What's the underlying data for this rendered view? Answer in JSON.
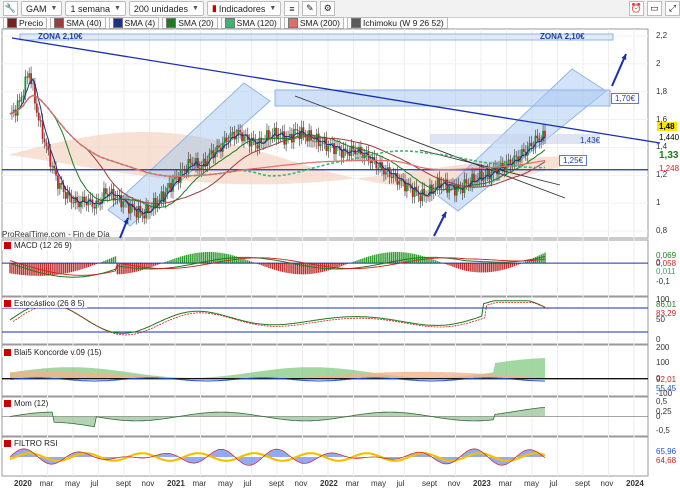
{
  "toolbar": {
    "symbol": "GAM",
    "timeframe": "1 semana",
    "units": "200 unidades",
    "indicators": "Indicadores"
  },
  "legend": [
    {
      "label": "Precio",
      "color": "#7a1f1f"
    },
    {
      "label": "SMA (40)",
      "color": "#9e3b3b"
    },
    {
      "label": "SMA (4)",
      "color": "#1c2f8a"
    },
    {
      "label": "SMA (20)",
      "color": "#1e7a1e"
    },
    {
      "label": "SMA (120)",
      "color": "#3cb371"
    },
    {
      "label": "SMA (200)",
      "color": "#e46a6a"
    },
    {
      "label": "Ichimoku (W 9 26 52)",
      "color": "#5a5a5a"
    }
  ],
  "annotations": {
    "zona_left": "ZONA 2,10€",
    "zona_right": "ZONA 2,10€",
    "target": "1,70€",
    "resistance": "1,43€",
    "support": "1,25€",
    "watermark": "ProRealTime.com - Fin de Día"
  },
  "price_labels": {
    "last": "1,48",
    "p2": "1,440",
    "p3": "1,33",
    "p4": "1,248"
  },
  "panels": {
    "macd": "MACD (12 26 9)",
    "macd_vals": [
      "0,069",
      "0,058",
      "0,011"
    ],
    "stoch": "Estocástico (26 8 5)",
    "stoch_vals": [
      "86,01",
      "83,29"
    ],
    "blai5": "Blai5 Koncorde v.09 (15)",
    "blai5_vals": [
      "92,01",
      "55,45"
    ],
    "mom": "Mom (12)",
    "mom_vals": [
      "0,25"
    ],
    "rsi": "FILTRO RSI",
    "rsi_vals": [
      "65,96",
      "64,68"
    ]
  },
  "colors": {
    "up": "#1f8f2f",
    "down": "#c2271f",
    "trend": "#1a2fb0",
    "channel": "#9ec3ef"
  },
  "chart_data": {
    "type": "line",
    "x_labels": [
      "2020",
      "mar",
      "may",
      "jul",
      "sept",
      "nov",
      "2021",
      "mar",
      "may",
      "jul",
      "sept",
      "nov",
      "2022",
      "mar",
      "may",
      "jul",
      "sept",
      "nov",
      "2023",
      "mar",
      "may",
      "jul",
      "sept",
      "nov",
      "2024"
    ],
    "price_axis_ticks": [
      "2,2",
      "2",
      "1,8",
      "1,6",
      "1,4",
      "1,2",
      "1",
      "0,8"
    ],
    "price_ylim": [
      0.75,
      2.25
    ],
    "price_close": [
      1.62,
      1.72,
      1.95,
      1.6,
      1.35,
      1.15,
      1.05,
      1.0,
      1.02,
      0.98,
      1.08,
      1.05,
      1.0,
      0.95,
      0.92,
      0.98,
      1.05,
      1.15,
      1.22,
      1.3,
      1.25,
      1.35,
      1.4,
      1.48,
      1.5,
      1.45,
      1.42,
      1.48,
      1.5,
      1.46,
      1.52,
      1.48,
      1.45,
      1.42,
      1.4,
      1.36,
      1.38,
      1.35,
      1.3,
      1.24,
      1.2,
      1.15,
      1.1,
      1.05,
      1.08,
      1.15,
      1.12,
      1.1,
      1.15,
      1.18,
      1.2,
      1.25,
      1.28,
      1.32,
      1.38,
      1.45,
      1.48
    ],
    "macd_axis_ticks": [
      "0",
      "-0,1"
    ],
    "stoch_axis_ticks": [
      "100",
      "50",
      "0"
    ],
    "blai5_axis_ticks": [
      "200",
      "100",
      "0",
      "-100"
    ],
    "mom_axis_ticks": [
      "0,5",
      "0",
      "-0,5"
    ]
  }
}
